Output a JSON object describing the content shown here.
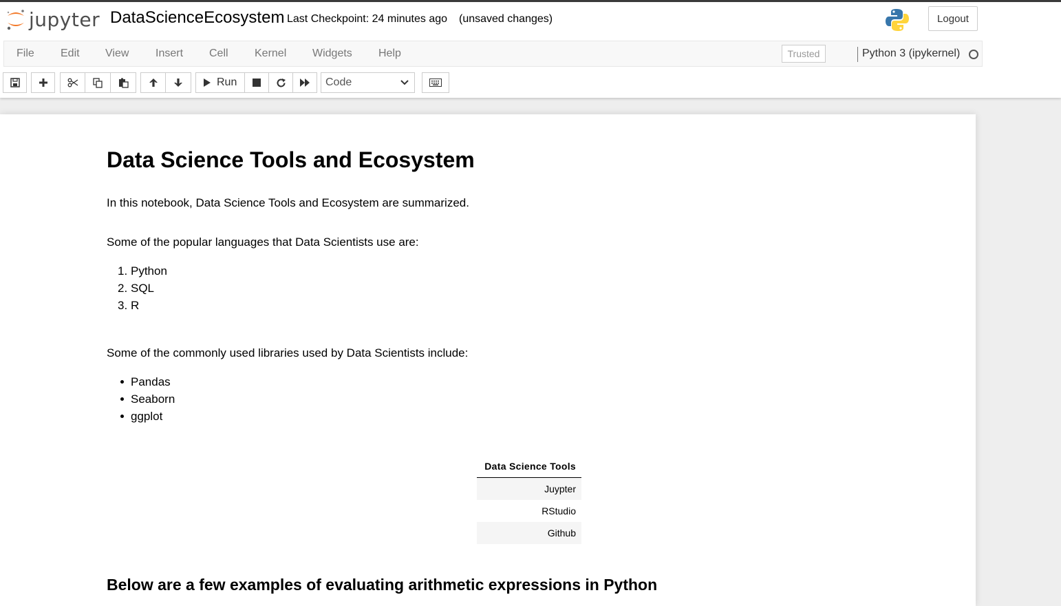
{
  "header": {
    "logo_text": "jupyter",
    "notebook_title": "DataScienceEcosystem",
    "checkpoint": "Last Checkpoint: 24 minutes ago",
    "autosave_status": "(unsaved changes)",
    "logout_label": "Logout"
  },
  "menubar": {
    "items": [
      "File",
      "Edit",
      "View",
      "Insert",
      "Cell",
      "Kernel",
      "Widgets",
      "Help"
    ],
    "trusted_label": "Trusted",
    "kernel_name": "Python 3 (ipykernel)"
  },
  "toolbar": {
    "run_label": "Run",
    "cell_type": "Code",
    "icons": [
      "save-icon",
      "plus-icon",
      "scissors-icon",
      "copy-icon",
      "paste-icon",
      "arrow-up-icon",
      "arrow-down-icon",
      "play-icon",
      "stop-icon",
      "restart-icon",
      "fast-forward-icon",
      "keyboard-icon"
    ]
  },
  "notebook": {
    "heading": "Data Science Tools and Ecosystem",
    "intro": "In this notebook, Data Science Tools and Ecosystem are summarized.",
    "languages_intro": "Some of the popular languages that Data Scientists use are:",
    "languages": [
      "Python",
      "SQL",
      "R"
    ],
    "libraries_intro": "Some of the commonly used libraries used by Data Scientists include:",
    "libraries": [
      "Pandas",
      "Seaborn",
      "ggplot"
    ],
    "tools_table": {
      "header": "Data Science Tools",
      "rows": [
        "Juypter",
        "RStudio",
        "Github"
      ]
    },
    "arithmetic_heading": "Below are a few examples of evaluating arithmetic expressions in Python"
  }
}
